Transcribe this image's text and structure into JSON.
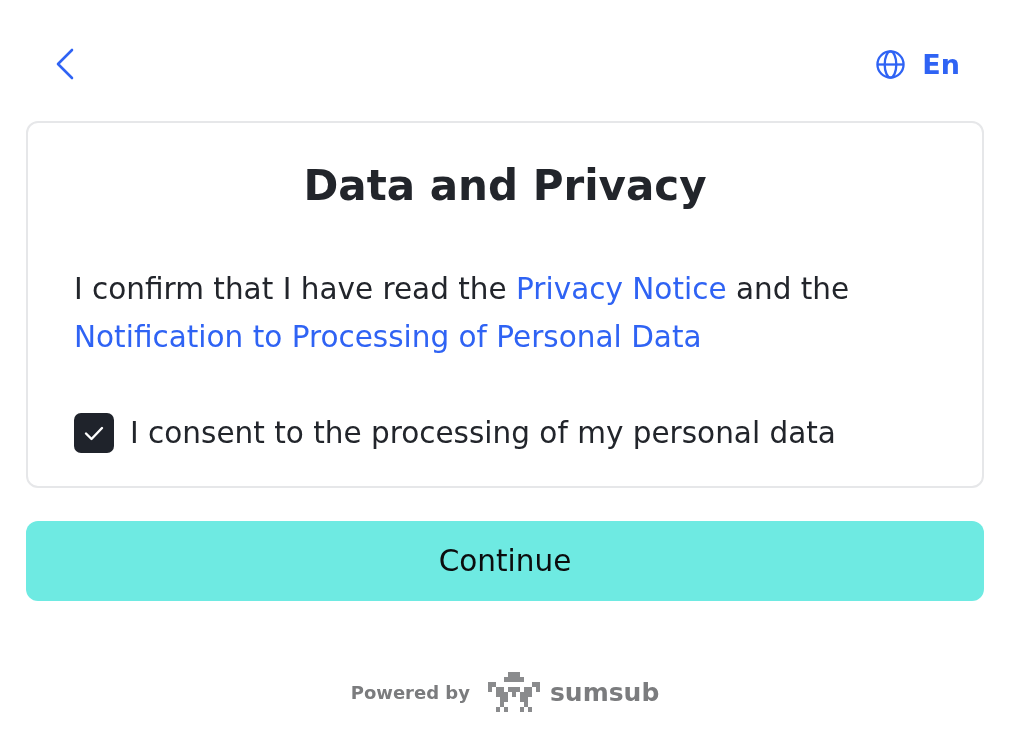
{
  "header": {
    "language": "En"
  },
  "card": {
    "title": "Data and Privacy",
    "statement": [
      {
        "kind": "text",
        "text": "I confirm that I have read the"
      },
      {
        "kind": "link",
        "text": "Privacy Notice"
      },
      {
        "kind": "text",
        "text": "and the"
      },
      {
        "kind": "link",
        "text": "Notification to Processing of Personal Data"
      }
    ],
    "consent": {
      "label": "I consent to the processing of my personal data",
      "checked": true
    }
  },
  "continue_button": {
    "label": "Continue"
  },
  "footer": {
    "powered_by": "Powered by",
    "brand": "sumsub"
  }
}
